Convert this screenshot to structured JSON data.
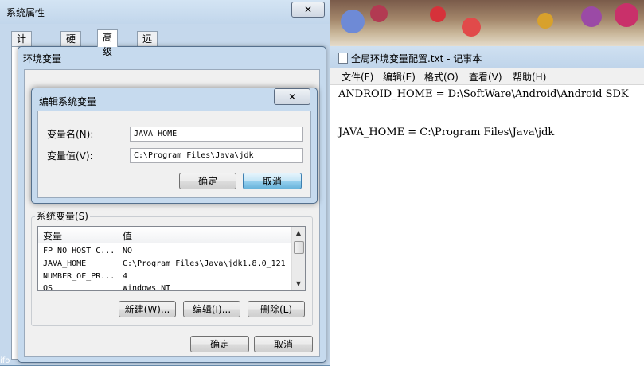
{
  "system_properties": {
    "title": "系统属性",
    "tabs": [
      "计算机名",
      "硬件",
      "高级",
      "远程"
    ],
    "active_tab": "高级"
  },
  "env_dialog": {
    "title": "环境变量",
    "system_vars_label": "系统变量(S)",
    "columns": [
      "变量",
      "值"
    ],
    "rows": [
      {
        "name": "FP_NO_HOST_C...",
        "value": "NO"
      },
      {
        "name": "JAVA_HOME",
        "value": "C:\\Program Files\\Java\\jdk1.8.0_121"
      },
      {
        "name": "NUMBER_OF_PR...",
        "value": "4"
      },
      {
        "name": "OS",
        "value": "Windows_NT"
      }
    ],
    "buttons": {
      "new": "新建(W)...",
      "edit": "编辑(I)...",
      "delete": "删除(L)"
    },
    "ok": "确定",
    "cancel": "取消"
  },
  "edit_dialog": {
    "title": "编辑系统变量",
    "name_label": "变量名(N):",
    "name_value": "JAVA_HOME",
    "value_label": "变量值(V):",
    "value_value": "C:\\Program Files\\Java\\jdk",
    "ok": "确定",
    "cancel": "取消"
  },
  "notepad": {
    "title": "全局环境变量配置.txt - 记事本",
    "menu": [
      "文件(F)",
      "编辑(E)",
      "格式(O)",
      "查看(V)",
      "帮助(H)"
    ],
    "lines": [
      "ANDROID_HOME = D:\\SoftWare\\Android\\Android SDK",
      "JAVA_HOME = C:\\Program Files\\Java\\jdk"
    ]
  },
  "desktop": {
    "caption": "ifo"
  },
  "colors": {
    "window_frame": "#c5d8ec",
    "focus_button": "#98d1ef"
  }
}
